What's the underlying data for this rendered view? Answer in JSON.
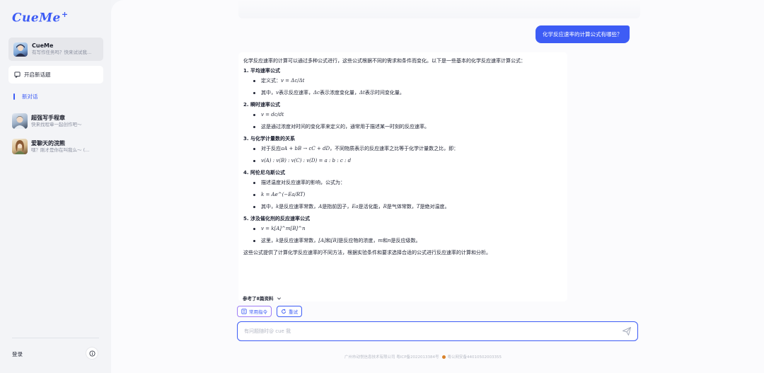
{
  "sidebar": {
    "logo": "CueMe",
    "logo_mark": "+",
    "bot": {
      "name": "CueMe",
      "subtitle": "有写作任务吗？快来试试我..."
    },
    "new_topic_label": "开启新话题",
    "current_chat_label": "新对话",
    "agents": [
      {
        "name": "超强写手程章",
        "subtitle": "快来找程章一起创作吧～"
      },
      {
        "name": "爱聊天的浣熊",
        "subtitle": "嘿？刚才是你在叫我么～ (..."
      }
    ],
    "login_label": "登录"
  },
  "chat": {
    "user_message": "化学反应速率的计算公式有哪些？",
    "answer": {
      "intro": "化学反应速率的计算可以通过多种公式进行，这些公式根据不同的需求和条件而变化。以下是一些基本的化学反应速率计算公式：",
      "sections": [
        {
          "title": "1. 平均速率公式",
          "b1_prefix": "定义式：",
          "b1_math": "v = Δc/Δt",
          "b2_p1": "其中，",
          "b2_m1": "v",
          "b2_p2": " 表示反应速率，",
          "b2_m2": "Δc",
          "b2_p3": " 表示浓度变化量，",
          "b2_m3": "Δt",
          "b2_p4": " 表示时间变化量。"
        },
        {
          "title": "2. 瞬时速率公式",
          "b1_math": "v = dc/dt",
          "b2_text": "这是通过浓度对时间的变化率来定义的，通常用于描述某一时刻的反应速率。"
        },
        {
          "title": "3. 与化学计量数的关系",
          "b1_p1": "对于反应 ",
          "b1_m1": "aA + bB → cC + dD",
          "b1_p2": " ，不同物质表示的反应速率之比等于化学计量数之比，即：",
          "b2_math": "v(A) : v(B) : v(C) : v(D) = a : b : c : d"
        },
        {
          "title": "4. 阿伦尼乌斯公式",
          "b1_text": "描述温度对反应速率的影响，公式为：",
          "b2_math": "k = Ae^(−Ea/RT)",
          "b3_p1": "其中，",
          "b3_m1": "k",
          "b3_p2": " 是反应速率常数，",
          "b3_m2": "A",
          "b3_p3": " 是指前因子，",
          "b3_m3": "Ea",
          "b3_p4": " 是活化能，",
          "b3_m4": "R",
          "b3_p5": " 是气体常数，",
          "b3_m5": "T",
          "b3_p6": " 是绝对温度。"
        },
        {
          "title": "5. 涉及催化剂的反应速率公式",
          "b1_math": "v = k[A]^m[B]^n",
          "b2_p1": "这里，",
          "b2_m1": "k",
          "b2_p2": " 是反应速率常数，",
          "b2_m2": "[A]",
          "b2_p3": " 和 ",
          "b2_m3": "[B]",
          "b2_p4": " 是反应物的浓度，",
          "b2_m4": "m",
          "b2_p5": " 和 ",
          "b2_m5": "n",
          "b2_p6": " 是反应级数。"
        }
      ],
      "summary": "这些公式提供了计算化学反应速率的不同方法，根据实验条件和要求选择合适的公式进行反应速率的计算和分析。"
    },
    "refs_label": "参考了8篇资料",
    "actions": {
      "commands_label": "常用指令",
      "retry_label": "重试"
    },
    "input": {
      "placeholder": "有问题随时@ cue 我",
      "value": ""
    },
    "footer": {
      "company": "广州市动悦信息技术有限公司 粤ICP备2022013384号",
      "police": "粤公网安备44010502003355"
    }
  },
  "colors": {
    "accent": "#3d5cf5",
    "sidebar_bg": "#f3f4f7",
    "main_bg": "#fbfbfd"
  }
}
